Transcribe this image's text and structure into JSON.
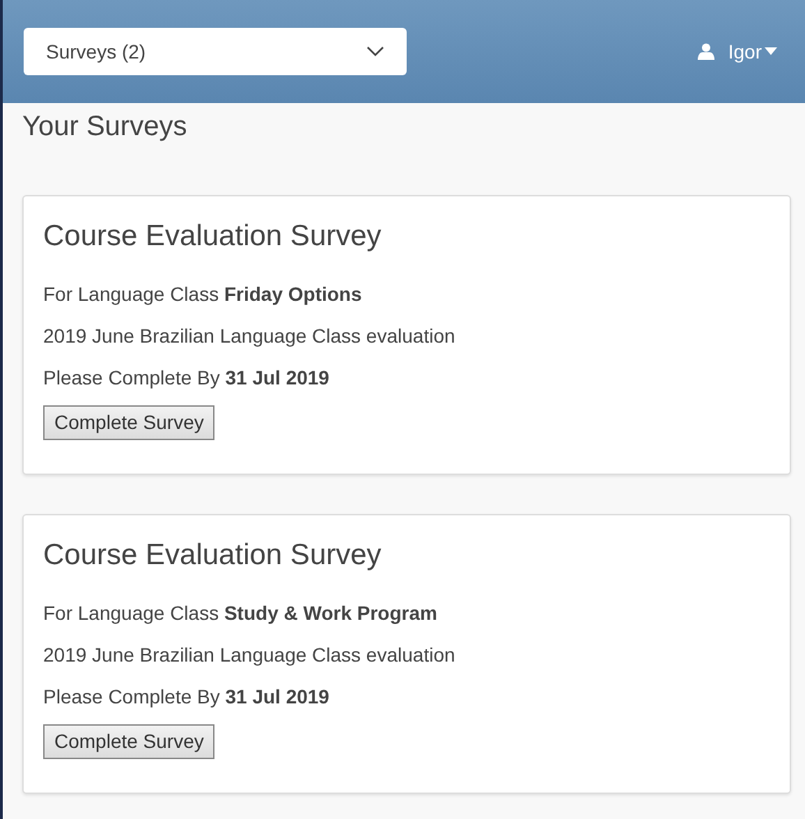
{
  "header": {
    "survey_select": {
      "value": "Surveys (2)"
    },
    "user_menu": {
      "label": "Igor"
    }
  },
  "page_title": "Your Surveys",
  "surveys": [
    {
      "title": "Course Evaluation Survey",
      "class_line": "For Language Class **Friday Options**",
      "description": "2019 June Brazilian Language Class evaluation",
      "due_line": "Please Complete By **31 Jul 2019**",
      "button": "Complete Survey"
    },
    {
      "title": "Course Evaluation Survey",
      "class_line": "For Language Class **Study & Work Program**",
      "description": "2019 June Brazilian Language Class evaluation",
      "due_line": "Please Complete By **31 Jul 2019**",
      "button": "Complete Survey"
    }
  ]
}
